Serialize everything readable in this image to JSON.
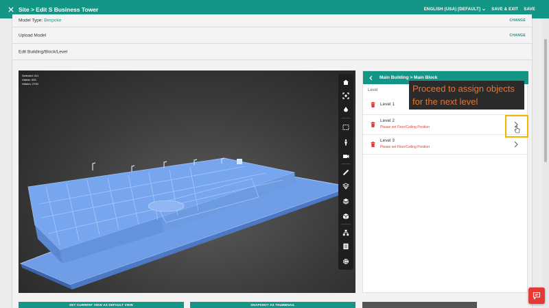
{
  "header": {
    "title": "Site > Edit S Business Tower",
    "language": "ENGLISH (USA) [DEFAULT]",
    "save_and_exit": "SAVE & EXIT",
    "save": "SAVE"
  },
  "form": {
    "model_type_label": "Model Type: ",
    "model_type_value": "Bespoke",
    "model_type_action": "CHANGE",
    "upload_model_label": "Upload Model",
    "upload_model_action": "CHANGE",
    "edit_building_label": "Edit Building/Block/Level"
  },
  "viewer": {
    "stats": {
      "selected": "Selected: 311",
      "visible": "Visible: 933",
      "hidden": "Hidden: 2790"
    },
    "toolbar_icons": [
      "home-icon",
      "fit-view-icon",
      "section-icon",
      "box-select-icon",
      "person-icon",
      "camera-icon",
      "measure-icon",
      "explode-icon",
      "layers-icon",
      "cube-icon",
      "tree-icon",
      "properties-icon",
      "settings-icon"
    ]
  },
  "panel": {
    "breadcrumb": "Main Building > Main Block",
    "column_header": "Level",
    "levels": [
      {
        "name": "Level 1",
        "warning": ""
      },
      {
        "name": "Level 2",
        "warning": "Please set Floor/Ceiling Position"
      },
      {
        "name": "Level 3",
        "warning": "Please set Floor/Ceiling Position"
      }
    ]
  },
  "callout": {
    "text": "Proceed to assign objects for the next level"
  },
  "bottom_buttons": {
    "default_view": "SET CURRENT VIEW AS DEFAULT VIEW",
    "snapshot": "SNAPSHOT AS THUMBNAIL"
  },
  "colors": {
    "accent": "#149686",
    "warning": "#e53935",
    "callout_text": "#e9722e",
    "highlight": "#f4b400"
  }
}
